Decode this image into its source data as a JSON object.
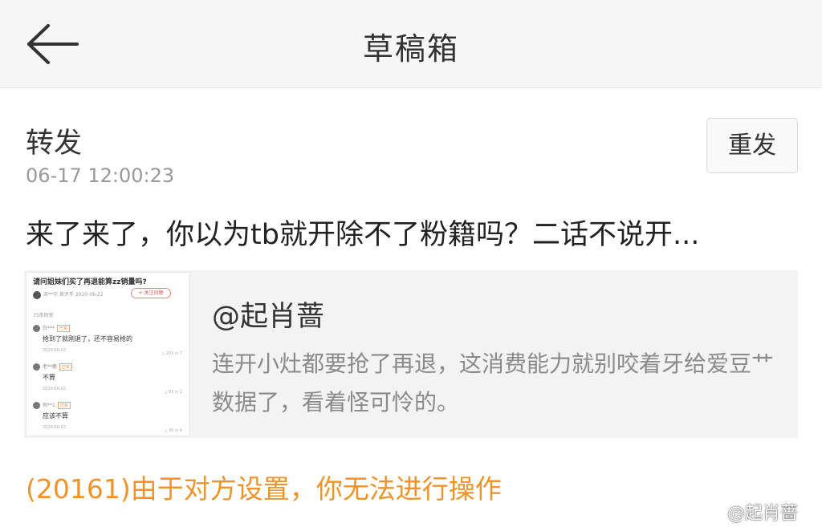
{
  "header": {
    "title": "草稿箱",
    "back_icon": "back-arrow-icon"
  },
  "draft": {
    "type": "转发",
    "time": "06-17 12:00:23",
    "resend_label": "重发",
    "text": "来了来了，你以为tb就开除不了粉籍吗？二话不说开..."
  },
  "quote": {
    "author": "@起肖蔷",
    "body": "连开小灶都要抢了再退，这消费能力就别咬着牙给爱豆艹数据了，看着怪可怜的。",
    "thumbnail": {
      "title": "请问姐妹们买了再退能算zz销量吗?",
      "user": "宋**宇  首评手  2020-06-22",
      "follow": "+ 关注问题",
      "count": "75条回答",
      "comments": [
        {
          "user": "白***",
          "tag": "已买",
          "text": "抢到了就刚退了，还不容易抢的",
          "date": "2020-06-02",
          "stats": "△ 203   ◷ 7"
        },
        {
          "user": "老**鹿",
          "tag": "已买",
          "text": "不算",
          "date": "2020-06-02",
          "stats": "△ 93   ◷ 2"
        },
        {
          "user": "何**1",
          "tag": "已买",
          "text": "应该不算",
          "date": "2020-06-02",
          "stats": "△ 30   ◷ 4"
        }
      ]
    }
  },
  "error": {
    "text": "(20161)由于对方设置，你无法进行操作"
  },
  "watermark": {
    "text": "@起肖蔷",
    "icon": "weibo-logo-icon"
  },
  "colors": {
    "error": "#f0942a",
    "header_bg": "#f7f7f7",
    "quote_bg": "#f3f3f3",
    "muted": "#999999"
  }
}
